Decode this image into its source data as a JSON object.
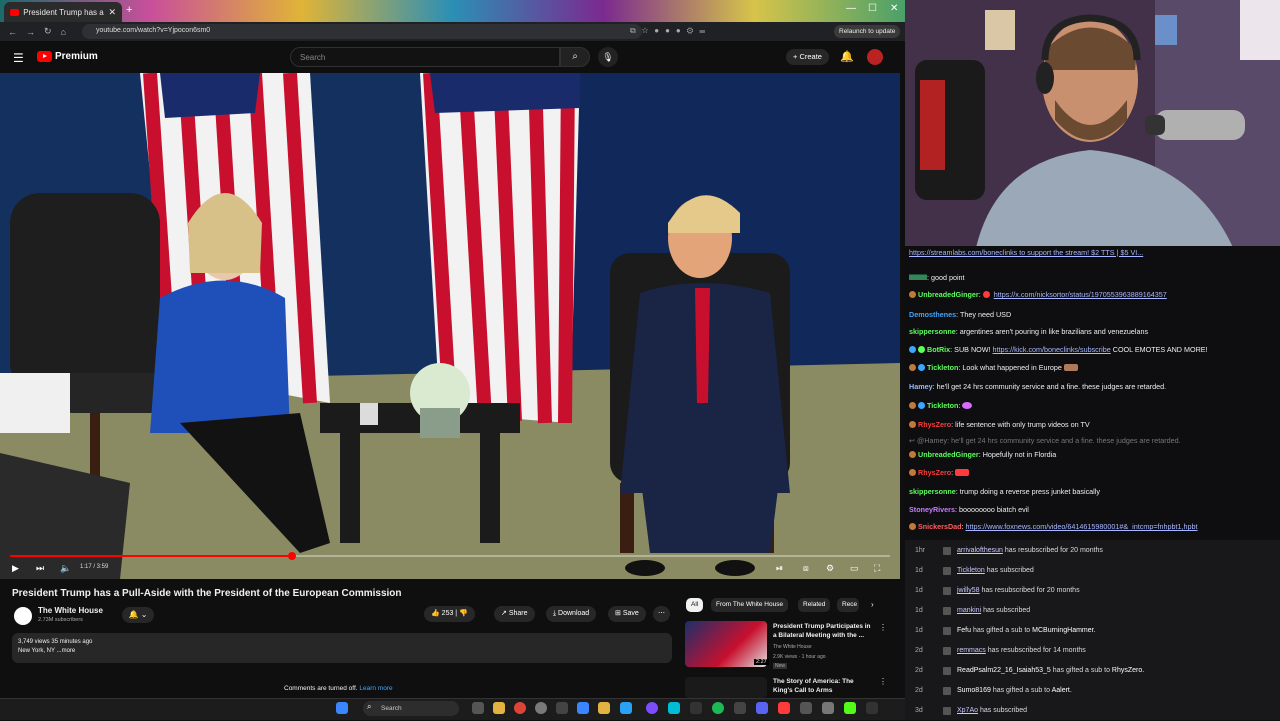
{
  "browser": {
    "tab_title": "President Trump has a Pull-Aside",
    "url": "youtube.com/watch?v=Yjpocon6sm0",
    "relaunch_label": "Relaunch to update"
  },
  "youtube": {
    "logo_label": "Premium",
    "search_placeholder": "Search",
    "create_label": "Create",
    "player": {
      "time": "1:17 / 3:59",
      "progress_fraction": 0.32
    },
    "video_title": "President Trump has a Pull-Aside with the President of the European Commission",
    "channel_name": "The White House",
    "channel_subs": "2.73M subscribers",
    "likes": "253",
    "share_label": "Share",
    "download_label": "Download",
    "save_label": "Save",
    "description_line1": "3,749 views  35 minutes ago",
    "description_line2": "New York, NY ...more",
    "comments_off": "Comments are turned off.",
    "learn_more": "Learn more",
    "chips": [
      "All",
      "From The White House",
      "Related",
      "Rece"
    ],
    "related": [
      {
        "title": "President Trump Participates in a Bilateral Meeting with the ...",
        "channel": "The White House",
        "meta": "2.9K views · 1 hour ago",
        "badge": "New",
        "duration": "2:27"
      },
      {
        "title": "The Story of America: The King's Call to Arms",
        "channel": "",
        "meta": "",
        "badge": "",
        "duration": ""
      }
    ]
  },
  "chat": {
    "banner": "https://streamlabs.com/boneclinks to support the stream! $2 TTS | $5 VI...",
    "messages": [
      {
        "user": "lllllllll",
        "color": "#5cffa0",
        "text": "good point",
        "link": ""
      },
      {
        "user": "UnbreadedGinger",
        "color": "#5cff5c",
        "text": "",
        "link": "https://x.com/nicksortor/status/1970553963889164357"
      },
      {
        "user": "Demosthenes",
        "color": "#3ea6ff",
        "text": "They need USD",
        "link": ""
      },
      {
        "user": "skippersonne",
        "color": "#5cff5c",
        "text": "argentines aren't pouring in like brazilians and venezuelans",
        "link": ""
      },
      {
        "user": "BotRix",
        "color": "#5cff5c",
        "text": "SUB NOW!",
        "link": "https://kick.com/boneclinks/subscribe",
        "tail": "COOL EMOTES AND MORE!"
      },
      {
        "user": "Tickleton",
        "color": "#5cff5c",
        "text": "Look what happened in Europe",
        "link": ""
      },
      {
        "user": "Hamey",
        "color": "#9ab8ff",
        "text": "he'll get 24 hrs community service and a fine. these judges are retarded.",
        "link": ""
      },
      {
        "user": "Tickleton",
        "color": "#5cff5c",
        "text": "",
        "link": ""
      },
      {
        "user": "RhysZero",
        "color": "#ff3b3b",
        "text": "life sentence with only trump videos on TV",
        "link": ""
      },
      {
        "user": "",
        "color": "#888888",
        "text": "@Hamey: he'll get 24 hrs community service and a fine. these judges are retarded.",
        "link": ""
      },
      {
        "user": "UnbreadedGinger",
        "color": "#5cff5c",
        "text": "Hopefully not in Flordia",
        "link": ""
      },
      {
        "user": "RhysZero",
        "color": "#ff3b3b",
        "text": "",
        "link": ""
      },
      {
        "user": "skippersonne",
        "color": "#5cff5c",
        "text": "trump doing a reverse press junket basically",
        "link": ""
      },
      {
        "user": "StoneyRivers",
        "color": "#c77dff",
        "text": "boooooooo biatch evil",
        "link": ""
      },
      {
        "user": "SnickersDad",
        "color": "#ff5c5c",
        "text": "",
        "link": "https://www.foxnews.com/video/6414615980001#&_intcmp=fnhpbt1,hpbt"
      }
    ]
  },
  "events": [
    {
      "time": "1hr",
      "user": "arrivalofthesun",
      "text": "has resubscribed for 20 months"
    },
    {
      "time": "1d",
      "user": "Tickleton",
      "text": "has subscribed"
    },
    {
      "time": "1d",
      "user": "jwilly58",
      "text": "has resubscribed for 20 months"
    },
    {
      "time": "1d",
      "user": "mankini",
      "text": "has subscribed"
    },
    {
      "time": "1d",
      "user": "Fefu",
      "text": "has gifted a sub to",
      "target": "MCBurningHammer."
    },
    {
      "time": "2d",
      "user": "remmacs",
      "text": "has resubscribed for 14 months"
    },
    {
      "time": "2d",
      "user": "ReadPsalm22_16_Isaiah53_5",
      "text": "has gifted a sub to",
      "target": "RhysZero."
    },
    {
      "time": "2d",
      "user": "Sumo8169",
      "text": "has gifted a sub to",
      "target": "Aalert."
    },
    {
      "time": "3d",
      "user": "Xp7Ao",
      "text": "has subscribed"
    }
  ],
  "taskbar": {
    "search_label": "Search"
  }
}
